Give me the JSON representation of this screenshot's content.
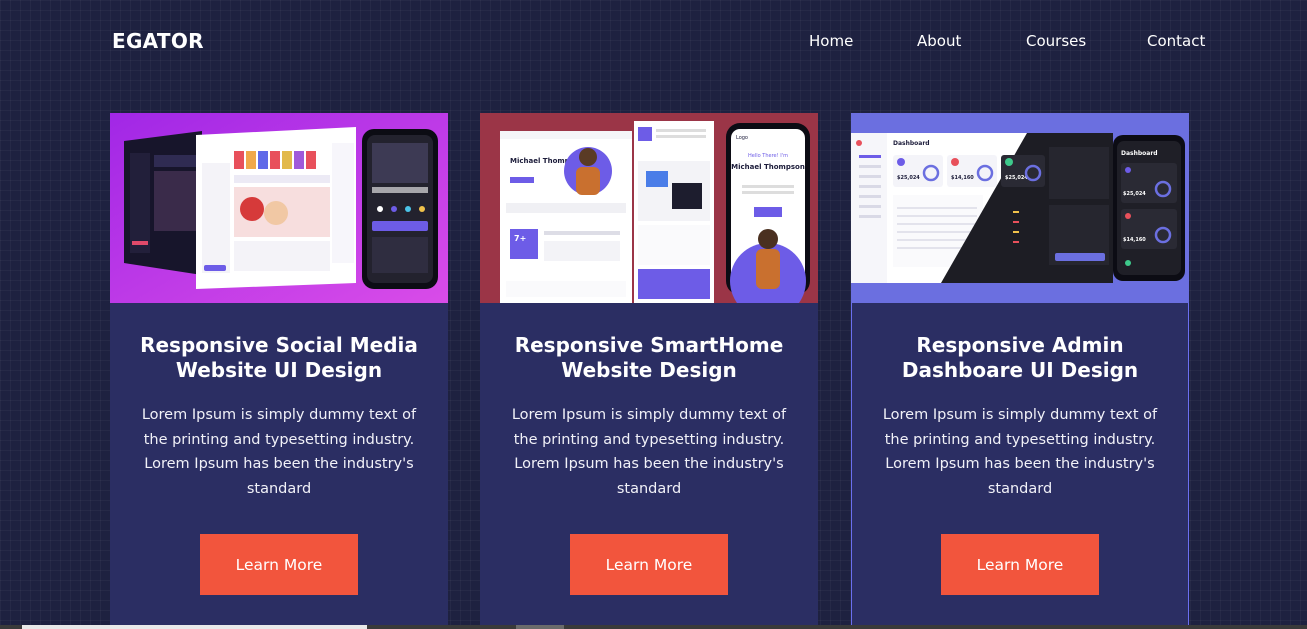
{
  "nav": {
    "logo": "EGATOR",
    "links": [
      "Home",
      "About",
      "Courses",
      "Contact"
    ]
  },
  "cards": [
    {
      "title_line1": "Responsive Social Media",
      "title_line2": "Website UI Design",
      "description": "Lorem Ipsum is simply dummy text of the printing and typesetting industry. Lorem Ipsum has been the industry's standard",
      "button": "Learn More",
      "image": "social-media-ui-mockup"
    },
    {
      "title_line1": "Responsive SmartHome",
      "title_line2": "Website Design",
      "description": "Lorem Ipsum is simply dummy text of the printing and typesetting industry. Lorem Ipsum has been the industry's standard",
      "button": "Learn More",
      "image": "smarthome-website-mockup",
      "mockup_text": {
        "hero_name": "Michael Thompson",
        "badge": "7+",
        "greeting": "Hello There! I'm",
        "phone_name": "Michael Thompson",
        "logo": "Logo"
      }
    },
    {
      "title_line1": "Responsive Admin",
      "title_line2": "Dashboare UI Design",
      "description": "Lorem Ipsum is simply dummy text of the printing and typesetting industry. Lorem Ipsum has been the industry's standard",
      "button": "Learn More",
      "image": "admin-dashboard-mockup",
      "mockup_text": {
        "title": "Dashboard",
        "stat1": "$25,024",
        "stat2": "$14,160",
        "stat3": "$25,024",
        "phone_title": "Dashboard",
        "phone_stat1": "$25,024",
        "phone_stat2": "$14,160"
      }
    }
  ],
  "colors": {
    "background": "#1e2140",
    "card": "#2b2e63",
    "button": "#f2553d",
    "accent": "#6b6ff0"
  }
}
